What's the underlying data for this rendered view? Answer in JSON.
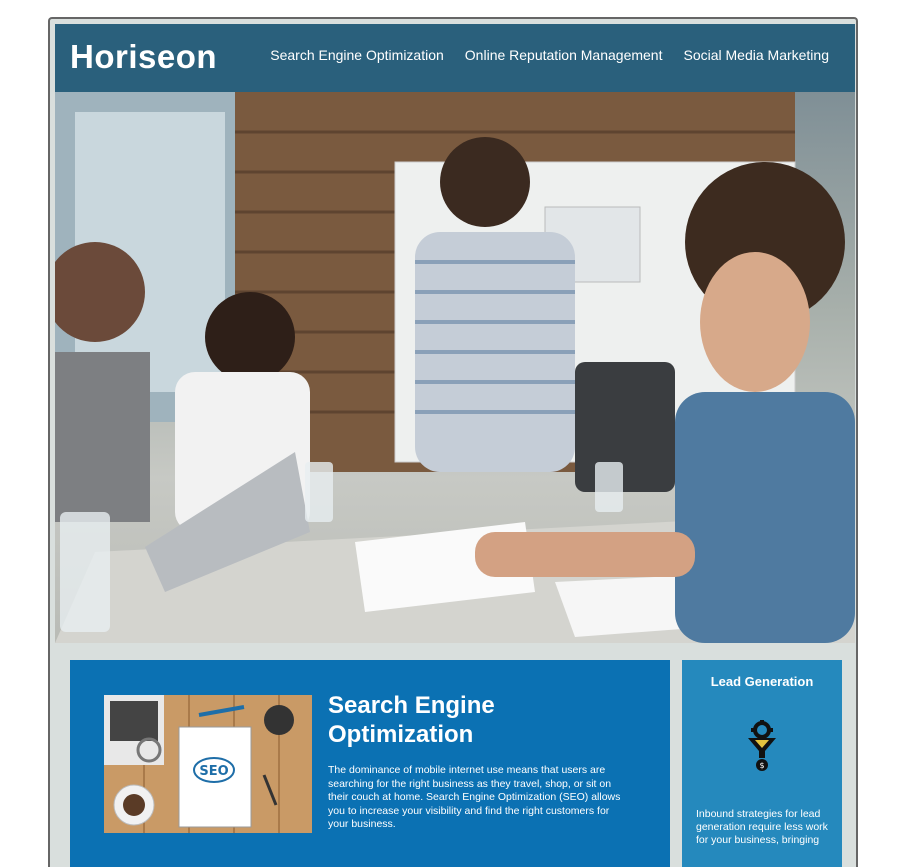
{
  "header": {
    "brand": "Horiseon",
    "nav": [
      {
        "label": "Search Engine Optimization"
      },
      {
        "label": "Online Reputation Management"
      },
      {
        "label": "Social Media Marketing"
      }
    ],
    "background_color": "#2a607c"
  },
  "hero": {
    "image_description": "hero-photo"
  },
  "search_engine_optimization": {
    "title_line1": "Search Engine",
    "title_line2": "Optimization",
    "body": "The dominance of mobile internet use means that users are searching for the right business as they travel, shop, or sit on their couch at home. Search Engine Optimization (SEO) allows you to increase your visibility and find the right customers for your business.",
    "image_label": "SEO",
    "background_color": "#0b71b3"
  },
  "lead_generation": {
    "title": "Lead Generation",
    "icon": "funnel-gear-icon",
    "body": "Inbound strategies for lead generation require less work for your business, bringing",
    "background_color": "#2589bd"
  }
}
